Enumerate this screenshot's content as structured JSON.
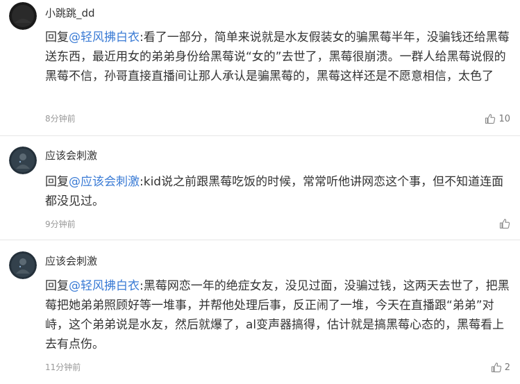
{
  "comments": [
    {
      "username": "小跳跳_dd",
      "reply_prefix": "回复",
      "mention": "@轻风拂白衣",
      "text": ":看了一部分，简单来说就是水友假装女的骗黑莓半年，没骗钱还给黑莓送东西，最近用女的弟弟身份给黑莓说“女的”去世了，黑莓很崩溃。一群人给黑莓说假的黑莓不信，孙哥直接直播间让那人承认是骗黑莓的，黑莓这样还是不愿意相信，太色了",
      "time": "8分钟前",
      "likes": "10",
      "avatar_icon": "dark-avatar"
    },
    {
      "username": "应该会刺激",
      "reply_prefix": "回复",
      "mention": "@应该会刺激",
      "text": ":kid说之前跟黑莓吃饭的时候，常常听他讲网恋这个事，但不知道连面都没见过。",
      "time": "9分钟前",
      "likes": "",
      "avatar_icon": "figure-avatar"
    },
    {
      "username": "应该会刺激",
      "reply_prefix": "回复",
      "mention": "@轻风拂白衣",
      "text": ":黑莓网恋一年的绝症女友，没见过面，没骗过钱，这两天去世了，把黑莓把她弟弟照顾好等一堆事，并帮他处理后事，反正闹了一堆，今天在直播跟“弟弟”对峙，这个弟弟说是水友，然后就爆了，al变声器搞得，估计就是搞黑莓心态的，黑莓看上去有点伤。",
      "time": "11分钟前",
      "likes": "2",
      "avatar_icon": "figure-avatar"
    }
  ],
  "colors": {
    "mention": "#3a7bd5",
    "text": "#333333",
    "time": "#999999"
  }
}
